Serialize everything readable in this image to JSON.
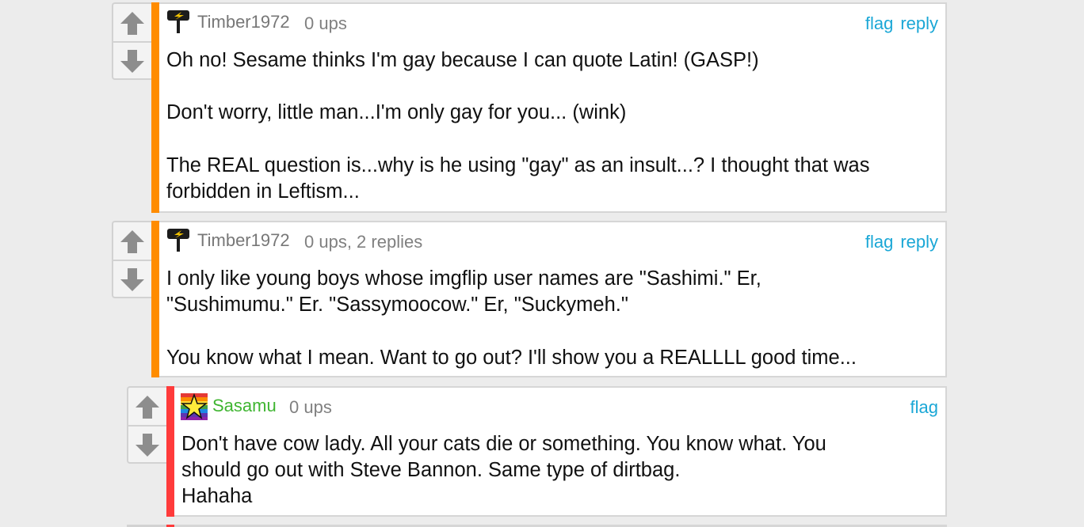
{
  "comments": [
    {
      "username": "Timber1972",
      "meta": "0 ups",
      "actions": {
        "flag": "flag",
        "reply": "reply"
      },
      "text": "Oh no! Sesame thinks I'm gay because I can quote Latin! (GASP!)\n\nDon't worry, little man...I'm only gay for you... (wink)\n\nThe REAL question is...why is he using \"gay\" as an insult...? I thought that was\nforbidden in Leftism..."
    },
    {
      "username": "Timber1972",
      "meta": "0 ups, 2 replies",
      "actions": {
        "flag": "flag",
        "reply": "reply"
      },
      "text": "I only like young boys whose imgflip user names are \"Sashimi.\" Er,\n\"Sushimumu.\" Er. \"Sassymoocow.\" Er, \"Suckymeh.\"\n\nYou know what I mean. Want to go out? I'll show you a REALLLL good time..."
    },
    {
      "username": "Sasamu",
      "meta": "0 ups",
      "actions": {
        "flag": "flag"
      },
      "text": "Don't have cow lady. All your cats die or something. You know what. You\nshould go out with Steve Bannon. Same type of dirtbag.\nHahaha"
    }
  ],
  "colors": {
    "bar_orange": "#ff8c00",
    "bar_red": "#ff3b3b",
    "link_blue": "#1aa7d6",
    "username_green": "#3fb531"
  }
}
